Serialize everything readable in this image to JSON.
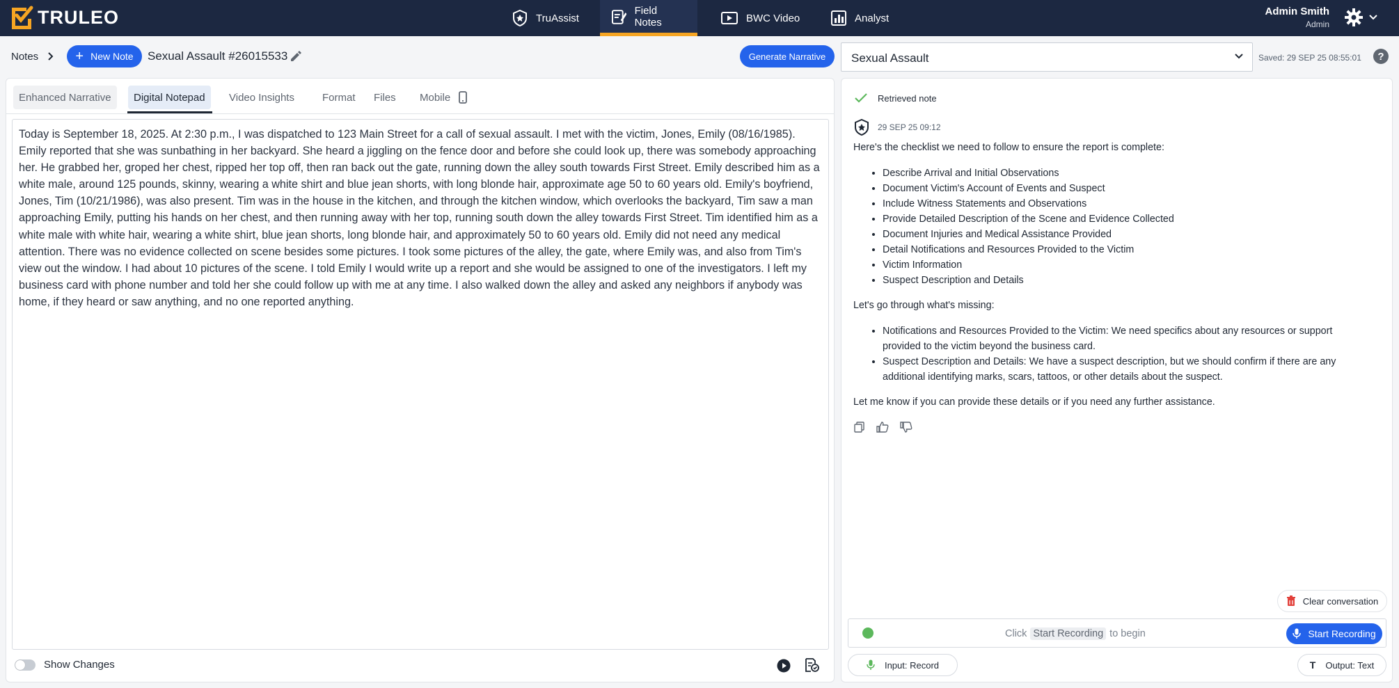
{
  "brand": {
    "name": "TRULEO"
  },
  "nav": {
    "items": [
      {
        "label": "TruAssist",
        "icon": "badge-icon"
      },
      {
        "label": "Field Notes",
        "icon": "notes-icon",
        "active": true
      },
      {
        "label": "BWC Video",
        "icon": "video-icon"
      },
      {
        "label": "Analyst",
        "icon": "chart-icon"
      }
    ],
    "accent_color": "#f6a523",
    "background_color": "#1c2841"
  },
  "user": {
    "name": "Admin Smith",
    "role": "Admin"
  },
  "subheader": {
    "breadcrumb": "Notes",
    "new_note_label": "New Note",
    "note_title": "Sexual Assault #26015533",
    "generate_label": "Generate Narrative",
    "template_select": "Sexual Assault",
    "saved_text": "Saved: 29 SEP 25 08:55:01",
    "help_label": "?"
  },
  "tabs": [
    {
      "label": "Enhanced Narrative"
    },
    {
      "label": "Digital Notepad",
      "active": true
    },
    {
      "label": "Video Insights"
    },
    {
      "label": "Format"
    },
    {
      "label": "Files"
    },
    {
      "label": "Mobile"
    }
  ],
  "notepad": {
    "text": "Today is September 18, 2025. At 2:30 p.m., I was dispatched to 123 Main Street for a call of sexual assault. I met with the victim, Jones, Emily (08/16/1985). Emily reported that she was sunbathing in her backyard. She heard a jiggling on the fence door and before she could look up, there was somebody approaching her. He grabbed her, groped her chest, ripped her top off, then ran back out the gate, running down the alley south towards First Street. Emily described him as a white male, around 125 pounds, skinny, wearing a white shirt and blue jean shorts, with long blonde hair, approximate age 50 to 60 years old. Emily's boyfriend, Jones, Tim (10/21/1986), was also present. Tim was in the house in the kitchen, and through the kitchen window, which overlooks the backyard, Tim saw a man approaching Emily, putting his hands on her chest, and then running away with her top, running south down the alley towards First Street. Tim identified him as a white male with white hair, wearing a white shirt, blue jean shorts, long blonde hair, and approximately 50 to 60 years old. Emily did not need any medical attention. There was no evidence collected on scene besides some pictures. I took some pictures of the alley, the gate, where Emily was, and also from Tim's view out the window. I had about 10 pictures of the scene. I told Emily I would write up a report and she would be assigned to one of the investigators. I left my business card with phone number and told her she could follow up with me at any time. I also walked down the alley and asked any neighbors if anybody was home, if they heard or saw anything, and no one reported anything.",
    "show_changes_label": "Show Changes"
  },
  "assistant": {
    "retrieved_label": "Retrieved note",
    "message_time": "29 SEP 25 09:12",
    "intro": "Here's the checklist we need to follow to ensure the report is complete:",
    "checklist": [
      "Describe Arrival and Initial Observations",
      "Document Victim's Account of Events and Suspect",
      "Include Witness Statements and Observations",
      "Provide Detailed Description of the Scene and Evidence Collected",
      "Document Injuries and Medical Assistance Provided",
      "Detail Notifications and Resources Provided to the Victim",
      "Victim Information",
      "Suspect Description and Details"
    ],
    "missing_intro": "Let's go through what's missing:",
    "missing": [
      "Notifications and Resources Provided to the Victim: We need specifics about any resources or support provided to the victim beyond the business card.",
      "Suspect Description and Details: We have a suspect description, but we should confirm if there are any additional identifying marks, scars, tattoos, or other details about the suspect."
    ],
    "closing": "Let me know if you can provide these details or if you need any further assistance.",
    "clear_label": "Clear conversation",
    "hint_prefix": "Click",
    "hint_chip": "Start Recording",
    "hint_suffix": "to begin",
    "start_recording_label": "Start Recording",
    "input_label": "Input: Record",
    "output_label": "Output: Text",
    "output_icon_glyph": "T"
  }
}
